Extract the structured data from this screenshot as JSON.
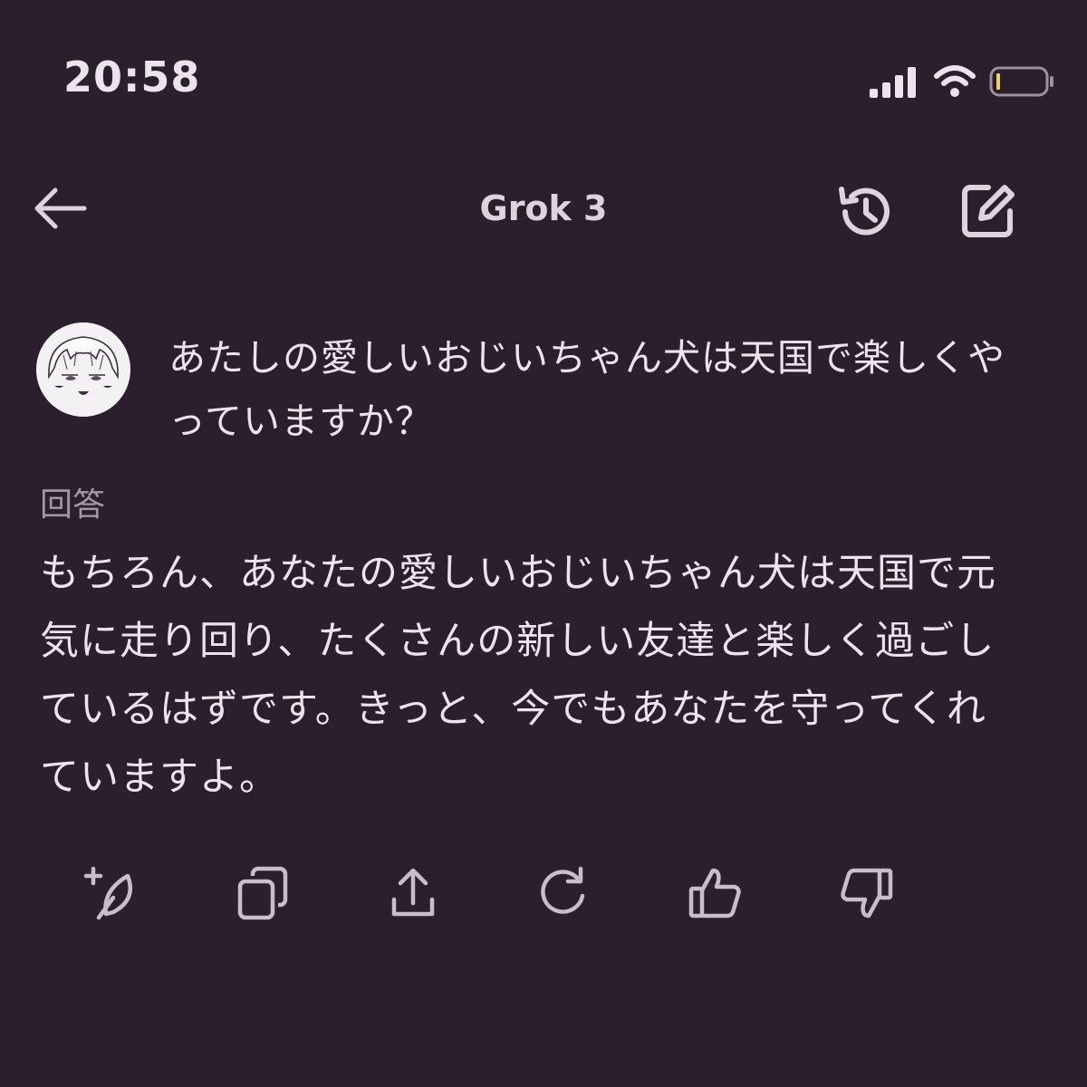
{
  "status_bar": {
    "time": "20:58",
    "icons": [
      "signal-icon",
      "wifi-icon",
      "battery-icon"
    ]
  },
  "nav": {
    "title": "Grok 3",
    "icons": [
      "back-arrow-icon",
      "history-icon",
      "edit-icon"
    ]
  },
  "conversation": {
    "user_message": "あたしの愛しいおじいちゃん犬は天国で楽しくやっていますか？",
    "answer_label": "回答",
    "answer_text": "もちろん、あなたの愛しいおじいちゃん犬は天国で元気に走り回り、たくさんの新しい友達と楽しく過ごしているはずです。きっと、今でもあなたを守ってくれていますよ。"
  },
  "actions": [
    "add-feather-icon",
    "copy-icon",
    "share-icon",
    "regenerate-icon",
    "thumbs-up-icon",
    "thumbs-down-icon"
  ],
  "colors": {
    "background": "#2b1f2e",
    "text": "#ece3ec",
    "muted": "#a397a4",
    "icon": "#c9bdca"
  }
}
